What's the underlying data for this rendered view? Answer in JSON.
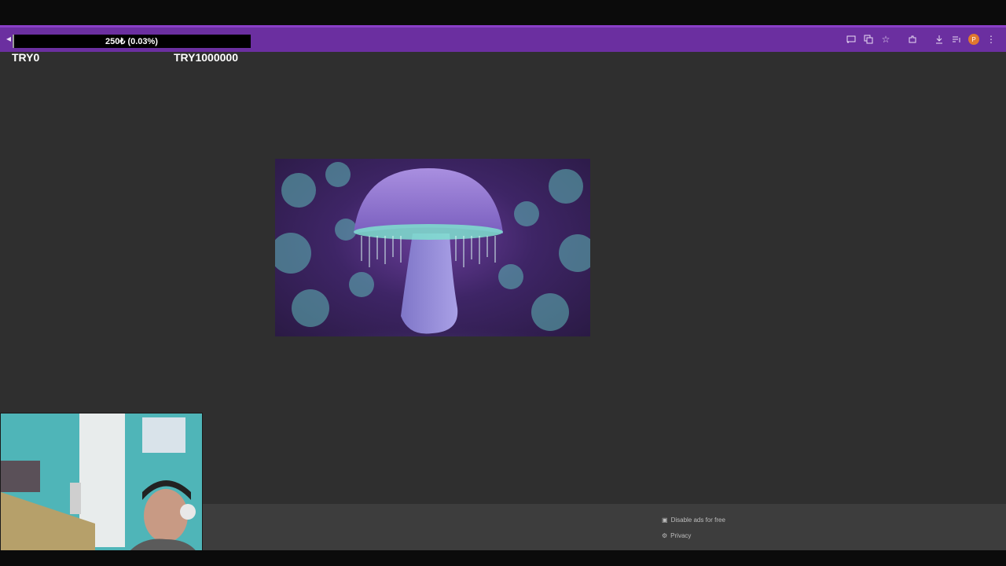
{
  "progress": {
    "text": "250₺ (0.03%)",
    "fraction": 0.0003
  },
  "counters": {
    "left": "TRY0",
    "right": "TRY1000000"
  },
  "browser": {
    "accent_color": "#6b2fa0",
    "profile_initial": "P",
    "icons": [
      "cast-icon",
      "translate-icon",
      "star-icon",
      "extension-icon",
      "download-icon",
      "media-icon",
      "profile-icon",
      "menu-icon"
    ]
  },
  "footer": {
    "disable_ads_label": "Disable ads for free",
    "privacy_label": "Privacy"
  }
}
